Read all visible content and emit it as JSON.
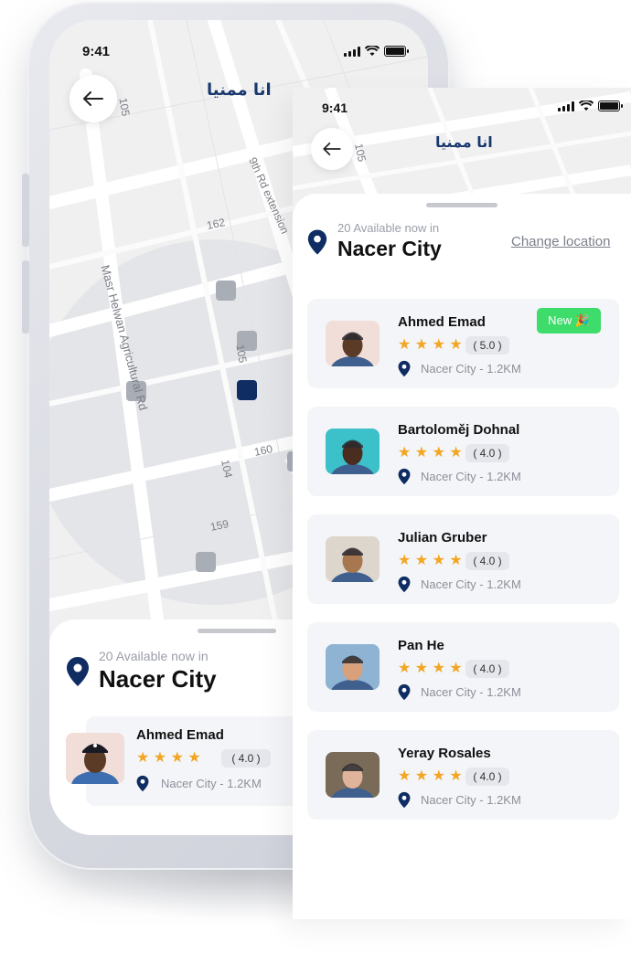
{
  "colors": {
    "brand_navy": "#19386e",
    "star": "#f2a623",
    "new_badge": "#3ddc6b",
    "card_bg": "#f4f5f8"
  },
  "back_phone": {
    "status_time": "9:41",
    "logo_text": "انا ممنيا",
    "map_labels": [
      "105",
      "9th Rd extension",
      "162",
      "Masr Helwan Agricultural Rd",
      "105",
      "160",
      "104",
      "159"
    ],
    "sheet": {
      "available_text": "20 Available now in",
      "city": "Nacer City",
      "card": {
        "name": "Ahmed Emad",
        "rating": "( 4.0 )",
        "location": "Nacer City - 1.2KM"
      }
    }
  },
  "front_screen": {
    "status_time": "9:41",
    "logo_text": "انا ممنيا",
    "map_label": "105",
    "available_text": "20 Available now in",
    "city": "Nacer City",
    "change_location": "Change location",
    "providers": [
      {
        "name": "Ahmed Emad",
        "rating": "( 5.0 )",
        "location": "Nacer City - 1.2KM",
        "badge": "New 🎉",
        "skin": "#5b3a26",
        "bg": "#f1ded8"
      },
      {
        "name": "Bartoloměj Dohnal",
        "rating": "( 4.0 )",
        "location": "Nacer City - 1.2KM",
        "badge": "",
        "skin": "#4a2d1f",
        "bg": "#3cc0c9"
      },
      {
        "name": "Julian Gruber",
        "rating": "( 4.0 )",
        "location": "Nacer City - 1.2KM",
        "badge": "",
        "skin": "#a8774f",
        "bg": "#dcd6cc"
      },
      {
        "name": "Pan He",
        "rating": "( 4.0 )",
        "location": "Nacer City - 1.2KM",
        "badge": "",
        "skin": "#d9a07c",
        "bg": "#8fb3d3"
      },
      {
        "name": "Yeray Rosales",
        "rating": "( 4.0 )",
        "location": "Nacer City - 1.2KM",
        "badge": "",
        "skin": "#e0b49a",
        "bg": "#7a6a58"
      }
    ]
  }
}
